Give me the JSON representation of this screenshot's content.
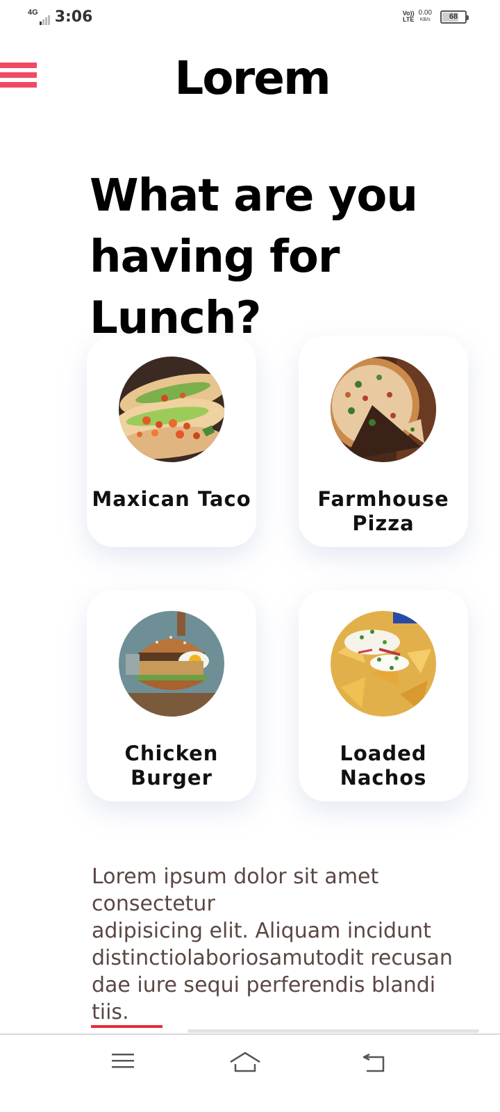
{
  "status_bar": {
    "network": "4G",
    "time": "3:06",
    "volte_top": "Vo))",
    "volte_bottom": "LTE",
    "speed": "0.00",
    "speed_unit": "KB/s",
    "battery": "68"
  },
  "app": {
    "title": "Lorem",
    "accent_color": "#f04a62"
  },
  "headline": "What are you having for Lunch?",
  "foods": [
    {
      "name": "Maxican Taco",
      "icon": "taco-photo"
    },
    {
      "name": "Farmhouse Pizza",
      "icon": "pizza-photo"
    },
    {
      "name": "Chicken Burger",
      "icon": "burger-photo"
    },
    {
      "name": "Loaded Nachos",
      "icon": "nachos-photo"
    }
  ],
  "description": "Lorem ipsum dolor sit amet consectetur\nadipisicing elit. Aliquam incidunt\ndistinctiolaboriosamutodit recusan\ndae iure sequi perferendis blandi\ntiis.",
  "nav": {
    "menu_icon": "menu-icon",
    "home_icon": "home-icon",
    "back_icon": "back-icon"
  }
}
